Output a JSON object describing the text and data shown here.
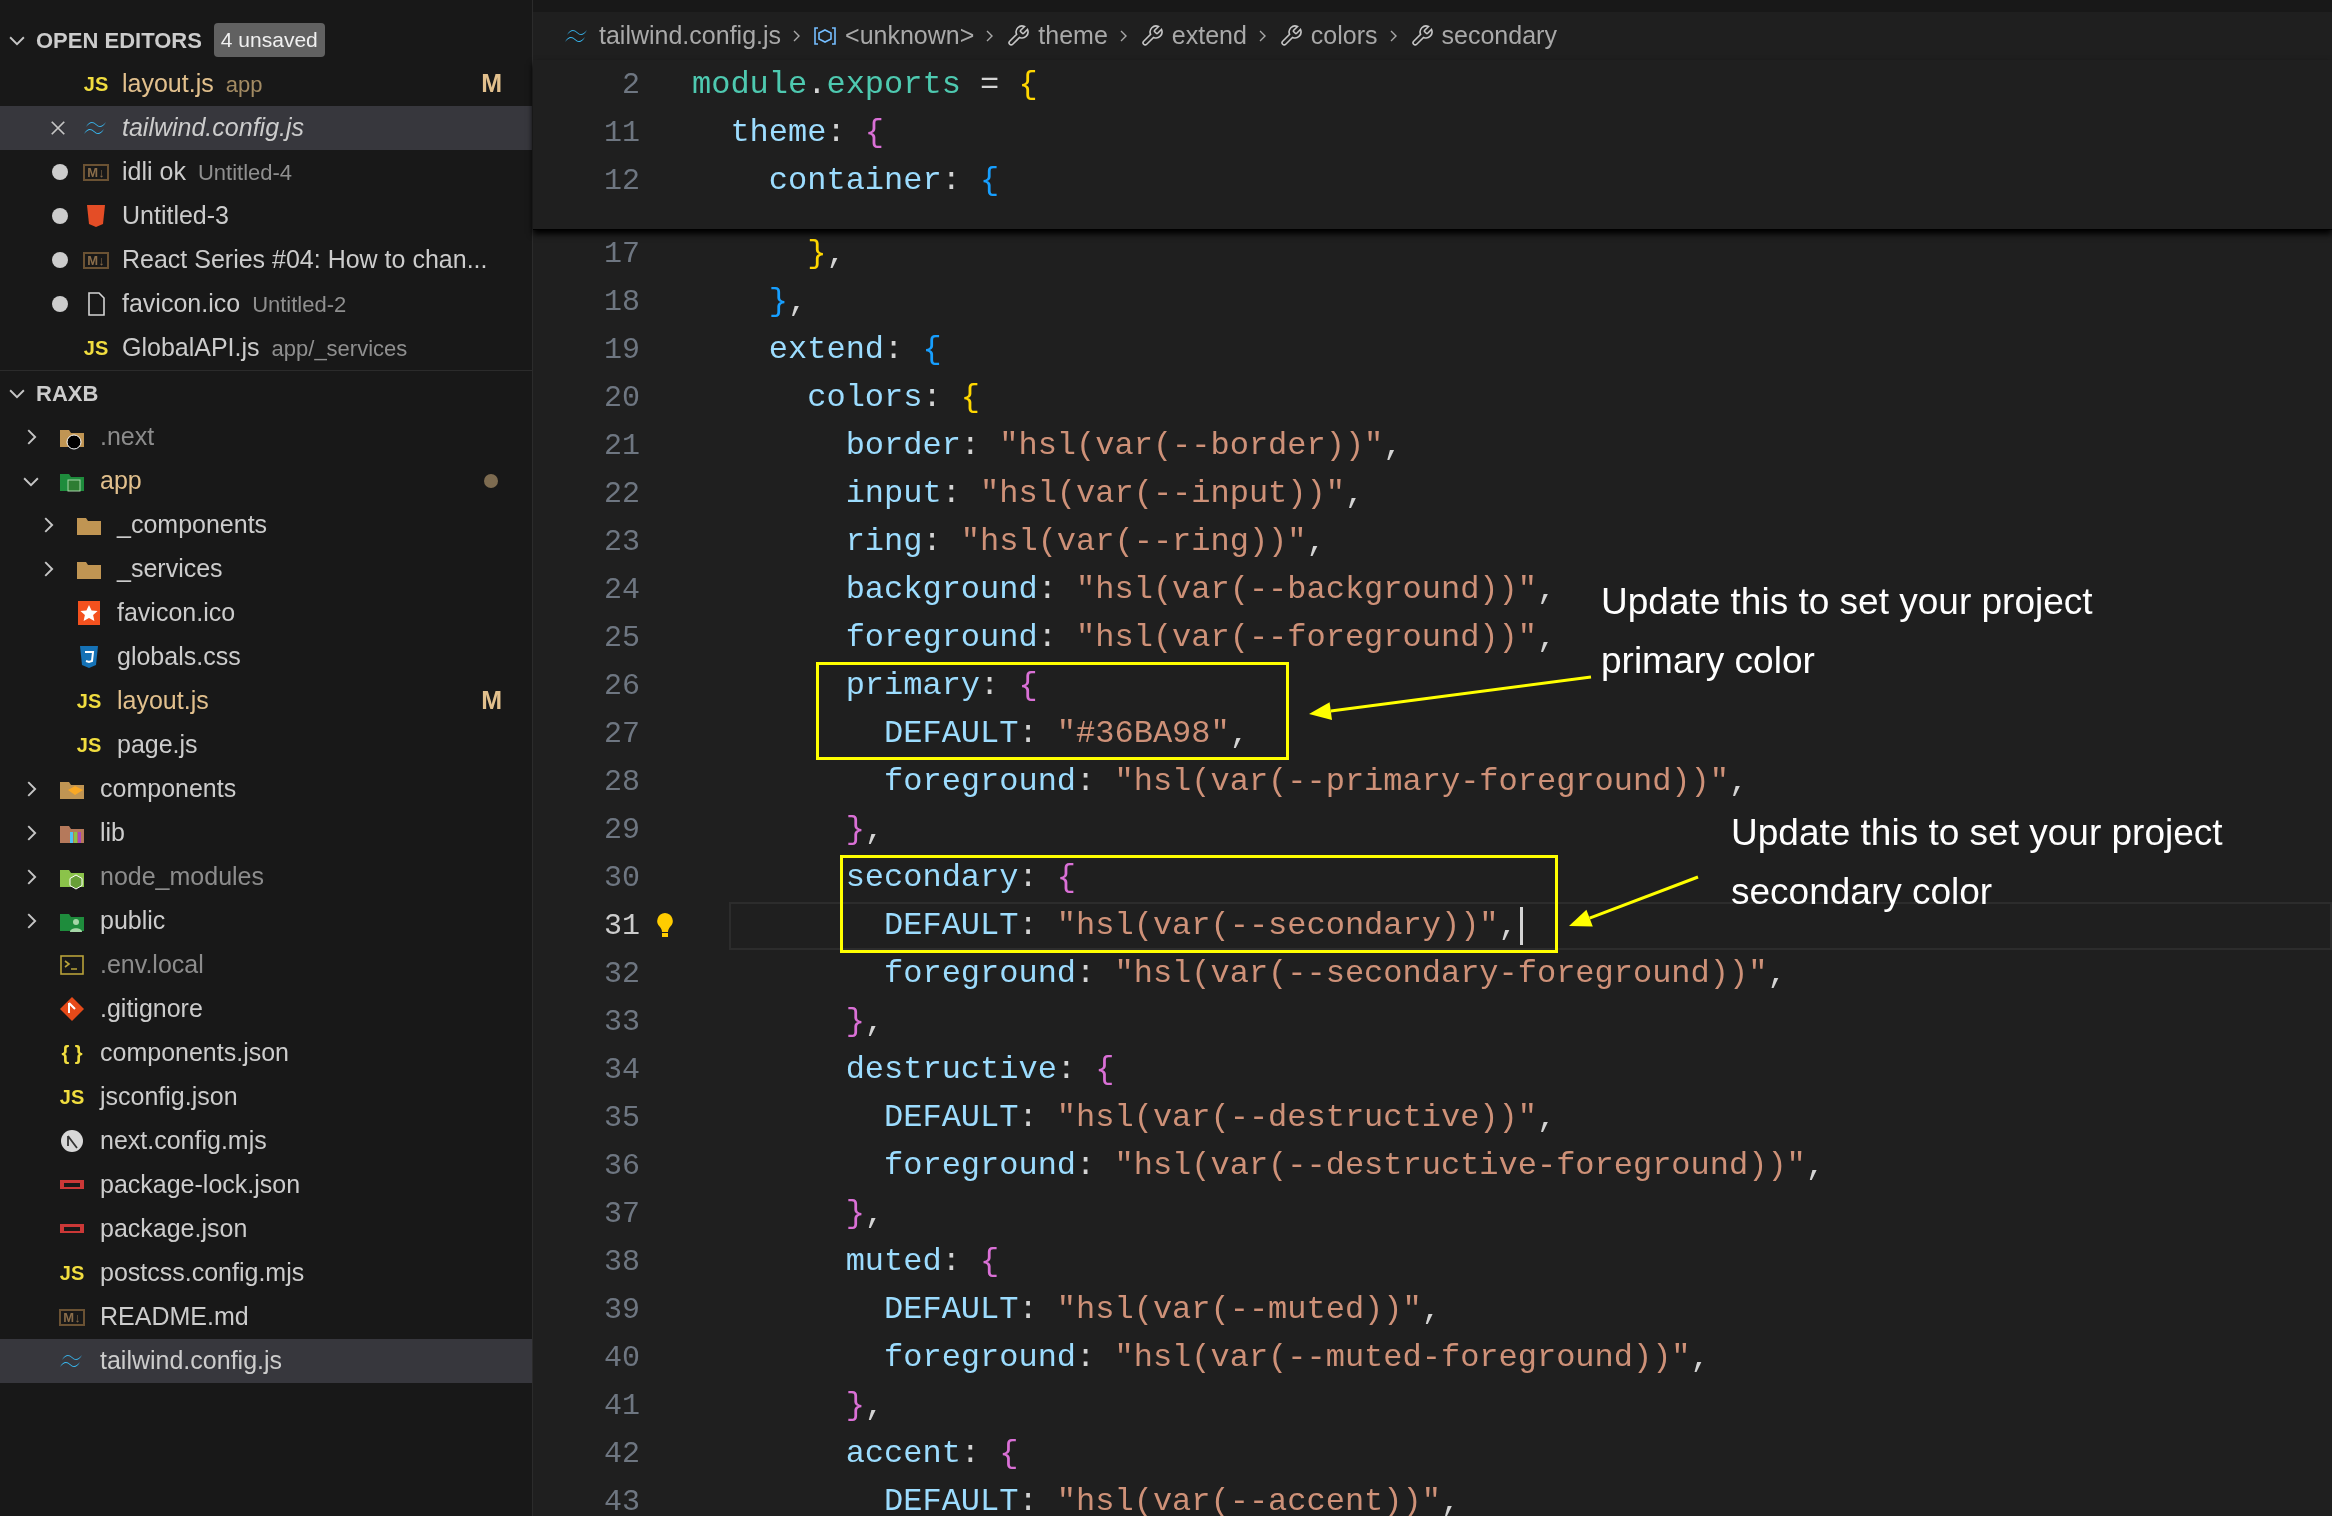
{
  "open_editors": {
    "title": "OPEN EDITORS",
    "expanded": true,
    "badge": "4 unsaved",
    "items": [
      {
        "name": "layout.js",
        "detail": "app",
        "kind": "js",
        "icon_text": "JS",
        "dirty": false,
        "selected": false,
        "preview": false,
        "modified": true,
        "badge": "M"
      },
      {
        "name": "tailwind.config.js",
        "kind": "tailwind",
        "selected": true,
        "preview": true,
        "modified": false
      },
      {
        "name": "idli ok",
        "detail": "Untitled-4",
        "kind": "md",
        "icon_text": "M↓",
        "dirty": true,
        "selected": false,
        "preview": false,
        "modified": false
      },
      {
        "name": "Untitled-3",
        "kind": "html",
        "dirty": true,
        "selected": false,
        "preview": false,
        "modified": false
      },
      {
        "name": "React Series #04: How to chan...",
        "kind": "md",
        "icon_text": "M↓",
        "dirty": true,
        "selected": false,
        "preview": false,
        "modified": false
      },
      {
        "name": "favicon.ico",
        "detail": "Untitled-2",
        "kind": "file",
        "dirty": true,
        "selected": false,
        "preview": false,
        "modified": false
      },
      {
        "name": "GlobalAPI.js",
        "detail": "app/_services",
        "kind": "js",
        "icon_text": "JS",
        "dirty": false,
        "selected": false,
        "preview": false,
        "modified": false
      }
    ]
  },
  "explorer": {
    "title": "RAXB",
    "expanded": true,
    "items": [
      {
        "name": ".next",
        "kind": "folder-next",
        "expanded": false,
        "ignored": true,
        "selected": false
      },
      {
        "name": "app",
        "kind": "folder-app",
        "expanded": true,
        "ignored": false,
        "modified": true,
        "selected": false,
        "children": [
          {
            "name": "_components",
            "kind": "folder",
            "expanded": false,
            "ignored": false,
            "selected": false
          },
          {
            "name": "_services",
            "kind": "folder",
            "expanded": false,
            "ignored": false,
            "selected": false
          },
          {
            "name": "favicon.ico",
            "kind": "favicon",
            "ignored": false,
            "selected": false
          },
          {
            "name": "globals.css",
            "kind": "css",
            "ignored": false,
            "selected": false
          },
          {
            "name": "layout.js",
            "kind": "js",
            "icon_text": "JS",
            "ignored": false,
            "modified": true,
            "badge": "M",
            "selected": false
          },
          {
            "name": "page.js",
            "kind": "js",
            "icon_text": "JS",
            "ignored": false,
            "selected": false
          }
        ]
      },
      {
        "name": "components",
        "kind": "folder-components",
        "expanded": false,
        "ignored": false,
        "selected": false
      },
      {
        "name": "lib",
        "kind": "folder-lib",
        "expanded": false,
        "ignored": false,
        "selected": false
      },
      {
        "name": "node_modules",
        "kind": "folder-node",
        "expanded": false,
        "ignored": true,
        "selected": false
      },
      {
        "name": "public",
        "kind": "folder-public",
        "expanded": false,
        "ignored": false,
        "selected": false
      },
      {
        "name": ".env.local",
        "kind": "terminal",
        "ignored": true,
        "selected": false
      },
      {
        "name": ".gitignore",
        "kind": "git",
        "ignored": false,
        "selected": false
      },
      {
        "name": "components.json",
        "kind": "json",
        "icon_text": "{ }",
        "ignored": false,
        "selected": false
      },
      {
        "name": "jsconfig.json",
        "kind": "js",
        "icon_text": "JS",
        "ignored": false,
        "selected": false
      },
      {
        "name": "next.config.mjs",
        "kind": "next",
        "ignored": false,
        "selected": false
      },
      {
        "name": "package-lock.json",
        "kind": "npm",
        "ignored": false,
        "selected": false
      },
      {
        "name": "package.json",
        "kind": "npm",
        "ignored": false,
        "selected": false
      },
      {
        "name": "postcss.config.mjs",
        "kind": "js",
        "icon_text": "JS",
        "ignored": false,
        "selected": false
      },
      {
        "name": "README.md",
        "kind": "md",
        "icon_text": "M↓",
        "ignored": false,
        "selected": false
      },
      {
        "name": "tailwind.config.js",
        "kind": "tailwind",
        "ignored": false,
        "selected": true
      }
    ]
  },
  "breadcrumb": [
    {
      "label": "tailwind.config.js",
      "kind": "tailwind"
    },
    {
      "label": "<unknown>",
      "kind": "symbol"
    },
    {
      "label": "theme",
      "kind": "wrench"
    },
    {
      "label": "extend",
      "kind": "wrench"
    },
    {
      "label": "colors",
      "kind": "wrench"
    },
    {
      "label": "secondary",
      "kind": "wrench"
    }
  ],
  "sticky_lines": [
    {
      "number": "2",
      "tokens": [
        {
          "kind": "ident",
          "text": "module"
        },
        {
          "kind": "punct",
          "text": "."
        },
        {
          "kind": "ident",
          "text": "exports"
        },
        {
          "kind": "punct",
          "text": " = "
        },
        {
          "kind": "bracket",
          "text": "{",
          "color": "#ffd700"
        }
      ]
    },
    {
      "number": "11",
      "tokens": [
        {
          "kind": "key",
          "text": "  theme"
        },
        {
          "kind": "punct",
          "text": ": "
        },
        {
          "kind": "bracket",
          "text": "{",
          "color": "#da70d6"
        }
      ]
    },
    {
      "number": "12",
      "tokens": [
        {
          "kind": "key",
          "text": "    container"
        },
        {
          "kind": "punct",
          "text": ": "
        },
        {
          "kind": "bracket",
          "text": "{",
          "color": "#179fff"
        }
      ]
    }
  ],
  "lines": [
    {
      "number": "17",
      "tokens": [
        {
          "kind": "bracket",
          "text": "      }",
          "color": "#ffd700"
        },
        {
          "kind": "punct",
          "text": ","
        }
      ]
    },
    {
      "number": "18",
      "tokens": [
        {
          "kind": "bracket",
          "text": "    }",
          "color": "#179fff"
        },
        {
          "kind": "punct",
          "text": ","
        }
      ]
    },
    {
      "number": "19",
      "tokens": [
        {
          "kind": "key",
          "text": "    extend"
        },
        {
          "kind": "punct",
          "text": ": "
        },
        {
          "kind": "bracket",
          "text": "{",
          "color": "#179fff"
        }
      ]
    },
    {
      "number": "20",
      "tokens": [
        {
          "kind": "key",
          "text": "      colors"
        },
        {
          "kind": "punct",
          "text": ": "
        },
        {
          "kind": "bracket",
          "text": "{",
          "color": "#ffd700"
        }
      ]
    },
    {
      "number": "21",
      "tokens": [
        {
          "kind": "key",
          "text": "        border"
        },
        {
          "kind": "punct",
          "text": ": "
        },
        {
          "kind": "string",
          "text": "\"hsl(var(--border))\""
        },
        {
          "kind": "punct",
          "text": ","
        }
      ]
    },
    {
      "number": "22",
      "tokens": [
        {
          "kind": "key",
          "text": "        input"
        },
        {
          "kind": "punct",
          "text": ": "
        },
        {
          "kind": "string",
          "text": "\"hsl(var(--input))\""
        },
        {
          "kind": "punct",
          "text": ","
        }
      ]
    },
    {
      "number": "23",
      "tokens": [
        {
          "kind": "key",
          "text": "        ring"
        },
        {
          "kind": "punct",
          "text": ": "
        },
        {
          "kind": "string",
          "text": "\"hsl(var(--ring))\""
        },
        {
          "kind": "punct",
          "text": ","
        }
      ]
    },
    {
      "number": "24",
      "tokens": [
        {
          "kind": "key",
          "text": "        background"
        },
        {
          "kind": "punct",
          "text": ": "
        },
        {
          "kind": "string",
          "text": "\"hsl(var(--background))\""
        },
        {
          "kind": "punct",
          "text": ","
        }
      ]
    },
    {
      "number": "25",
      "tokens": [
        {
          "kind": "key",
          "text": "        foreground"
        },
        {
          "kind": "punct",
          "text": ": "
        },
        {
          "kind": "string",
          "text": "\"hsl(var(--foreground))\""
        },
        {
          "kind": "punct",
          "text": ","
        }
      ]
    },
    {
      "number": "26",
      "tokens": [
        {
          "kind": "key",
          "text": "        primary"
        },
        {
          "kind": "punct",
          "text": ": "
        },
        {
          "kind": "bracket",
          "text": "{",
          "color": "#da70d6"
        }
      ]
    },
    {
      "number": "27",
      "tokens": [
        {
          "kind": "key",
          "text": "          DEFAULT"
        },
        {
          "kind": "punct",
          "text": ": "
        },
        {
          "kind": "string",
          "text": "\"#36BA98\""
        },
        {
          "kind": "punct",
          "text": ","
        }
      ]
    },
    {
      "number": "28",
      "tokens": [
        {
          "kind": "key",
          "text": "          foreground"
        },
        {
          "kind": "punct",
          "text": ": "
        },
        {
          "kind": "string",
          "text": "\"hsl(var(--primary-foreground))\""
        },
        {
          "kind": "punct",
          "text": ","
        }
      ]
    },
    {
      "number": "29",
      "tokens": [
        {
          "kind": "bracket",
          "text": "        }",
          "color": "#da70d6"
        },
        {
          "kind": "punct",
          "text": ","
        }
      ]
    },
    {
      "number": "30",
      "tokens": [
        {
          "kind": "key",
          "text": "        secondary"
        },
        {
          "kind": "punct",
          "text": ": "
        },
        {
          "kind": "bracket",
          "text": "{",
          "color": "#da70d6"
        }
      ]
    },
    {
      "number": "31",
      "current": true,
      "lightbulb": true,
      "cursor": true,
      "tokens": [
        {
          "kind": "key",
          "text": "          DEFAULT"
        },
        {
          "kind": "punct",
          "text": ": "
        },
        {
          "kind": "string",
          "text": "\"hsl(var(--secondary))\""
        },
        {
          "kind": "punct",
          "text": ","
        }
      ]
    },
    {
      "number": "32",
      "tokens": [
        {
          "kind": "key",
          "text": "          foreground"
        },
        {
          "kind": "punct",
          "text": ": "
        },
        {
          "kind": "string",
          "text": "\"hsl(var(--secondary-foreground))\""
        },
        {
          "kind": "punct",
          "text": ","
        }
      ]
    },
    {
      "number": "33",
      "tokens": [
        {
          "kind": "bracket",
          "text": "        }",
          "color": "#da70d6"
        },
        {
          "kind": "punct",
          "text": ","
        }
      ]
    },
    {
      "number": "34",
      "tokens": [
        {
          "kind": "key",
          "text": "        destructive"
        },
        {
          "kind": "punct",
          "text": ": "
        },
        {
          "kind": "bracket",
          "text": "{",
          "color": "#da70d6"
        }
      ]
    },
    {
      "number": "35",
      "tokens": [
        {
          "kind": "key",
          "text": "          DEFAULT"
        },
        {
          "kind": "punct",
          "text": ": "
        },
        {
          "kind": "string",
          "text": "\"hsl(var(--destructive))\""
        },
        {
          "kind": "punct",
          "text": ","
        }
      ]
    },
    {
      "number": "36",
      "tokens": [
        {
          "kind": "key",
          "text": "          foreground"
        },
        {
          "kind": "punct",
          "text": ": "
        },
        {
          "kind": "string",
          "text": "\"hsl(var(--destructive-foreground))\""
        },
        {
          "kind": "punct",
          "text": ","
        }
      ]
    },
    {
      "number": "37",
      "tokens": [
        {
          "kind": "bracket",
          "text": "        }",
          "color": "#da70d6"
        },
        {
          "kind": "punct",
          "text": ","
        }
      ]
    },
    {
      "number": "38",
      "tokens": [
        {
          "kind": "key",
          "text": "        muted"
        },
        {
          "kind": "punct",
          "text": ": "
        },
        {
          "kind": "bracket",
          "text": "{",
          "color": "#da70d6"
        }
      ]
    },
    {
      "number": "39",
      "tokens": [
        {
          "kind": "key",
          "text": "          DEFAULT"
        },
        {
          "kind": "punct",
          "text": ": "
        },
        {
          "kind": "string",
          "text": "\"hsl(var(--muted))\""
        },
        {
          "kind": "punct",
          "text": ","
        }
      ]
    },
    {
      "number": "40",
      "tokens": [
        {
          "kind": "key",
          "text": "          foreground"
        },
        {
          "kind": "punct",
          "text": ": "
        },
        {
          "kind": "string",
          "text": "\"hsl(var(--muted-foreground))\""
        },
        {
          "kind": "punct",
          "text": ","
        }
      ]
    },
    {
      "number": "41",
      "tokens": [
        {
          "kind": "bracket",
          "text": "        }",
          "color": "#da70d6"
        },
        {
          "kind": "punct",
          "text": ","
        }
      ]
    },
    {
      "number": "42",
      "tokens": [
        {
          "kind": "key",
          "text": "        accent"
        },
        {
          "kind": "punct",
          "text": ": "
        },
        {
          "kind": "bracket",
          "text": "{",
          "color": "#da70d6"
        }
      ]
    },
    {
      "number": "43",
      "tokens": [
        {
          "kind": "key",
          "text": "          DEFAULT"
        },
        {
          "kind": "punct",
          "text": ": "
        },
        {
          "kind": "string",
          "text": "\"hsl(var(--accent))\""
        },
        {
          "kind": "punct",
          "text": ","
        }
      ]
    }
  ],
  "annotations": [
    {
      "text": "Update this to set your project primary color"
    },
    {
      "text": "Update this to set your project secondary color"
    }
  ]
}
